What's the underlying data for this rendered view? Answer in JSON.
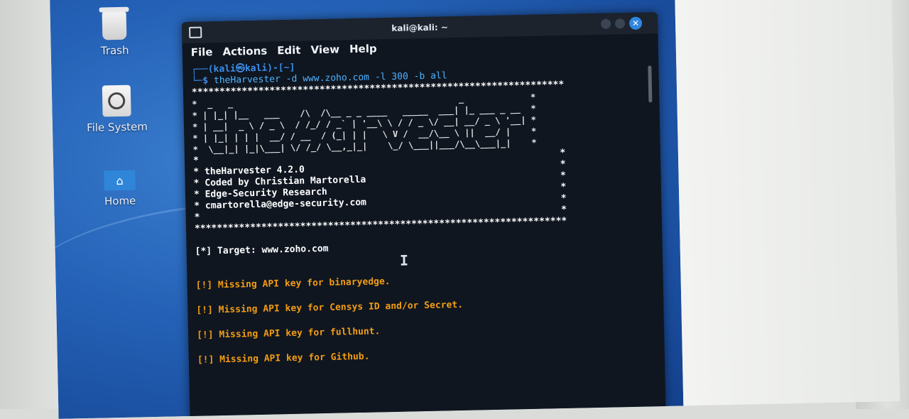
{
  "desktop": {
    "icons": [
      {
        "label": "Trash",
        "icon": "trash-icon"
      },
      {
        "label": "File System",
        "icon": "drive-icon"
      },
      {
        "label": "Home",
        "icon": "home-folder-icon"
      }
    ]
  },
  "window": {
    "title": "kali@kali: ~",
    "close_glyph": "✕",
    "menu": [
      "File",
      "Actions",
      "Edit",
      "View",
      "Help"
    ]
  },
  "terminal": {
    "prompt_line1": "┌──(kali㉿kali)-[~]",
    "prompt_line2_prefix": "└─$ ",
    "command": "theHarvester -d www.zoho.com -l 300 -b all",
    "stars_line": "*******************************************************************",
    "banner_ascii": [
      "*  _   _                                            _             *",
      "* | |_| |__   ___    /\\  /\\__ _ _ ____   _____  ___| |_ ___ _ __  *",
      "* | __|  _ \\ / _ \\  / /_/ / _` | '__\\ \\ / / _ \\/ __| __/ _ \\ '__| *",
      "* | |_| | | |  __/ / __  / (_| | |   \\ V /  __/\\__ \\ ||  __/ |    *",
      "*  \\__|_| |_|\\___| \\/ /_/ \\__,_|_|    \\_/ \\___||___/\\__\\___|_|    *"
    ],
    "banner_blank": "*                                                                 *",
    "banner_info": [
      "* theHarvester 4.2.0                                              *",
      "* Coded by Christian Martorella                                   *",
      "* Edge-Security Research                                          *",
      "* cmartorella@edge-security.com                                   *"
    ],
    "target_line": "[*] Target: www.zoho.com",
    "warnings": [
      "[!] Missing API key for binaryedge.",
      "[!] Missing API key for Censys ID and/or Secret.",
      "[!] Missing API key for fullhunt.",
      "[!] Missing API key for Github."
    ],
    "cursor_glyph": "I"
  },
  "colors": {
    "terminal_bg": "#0f1620",
    "prompt_blue": "#3b8eea",
    "warning_orange": "#f39c12",
    "close_button": "#2f86e0"
  }
}
